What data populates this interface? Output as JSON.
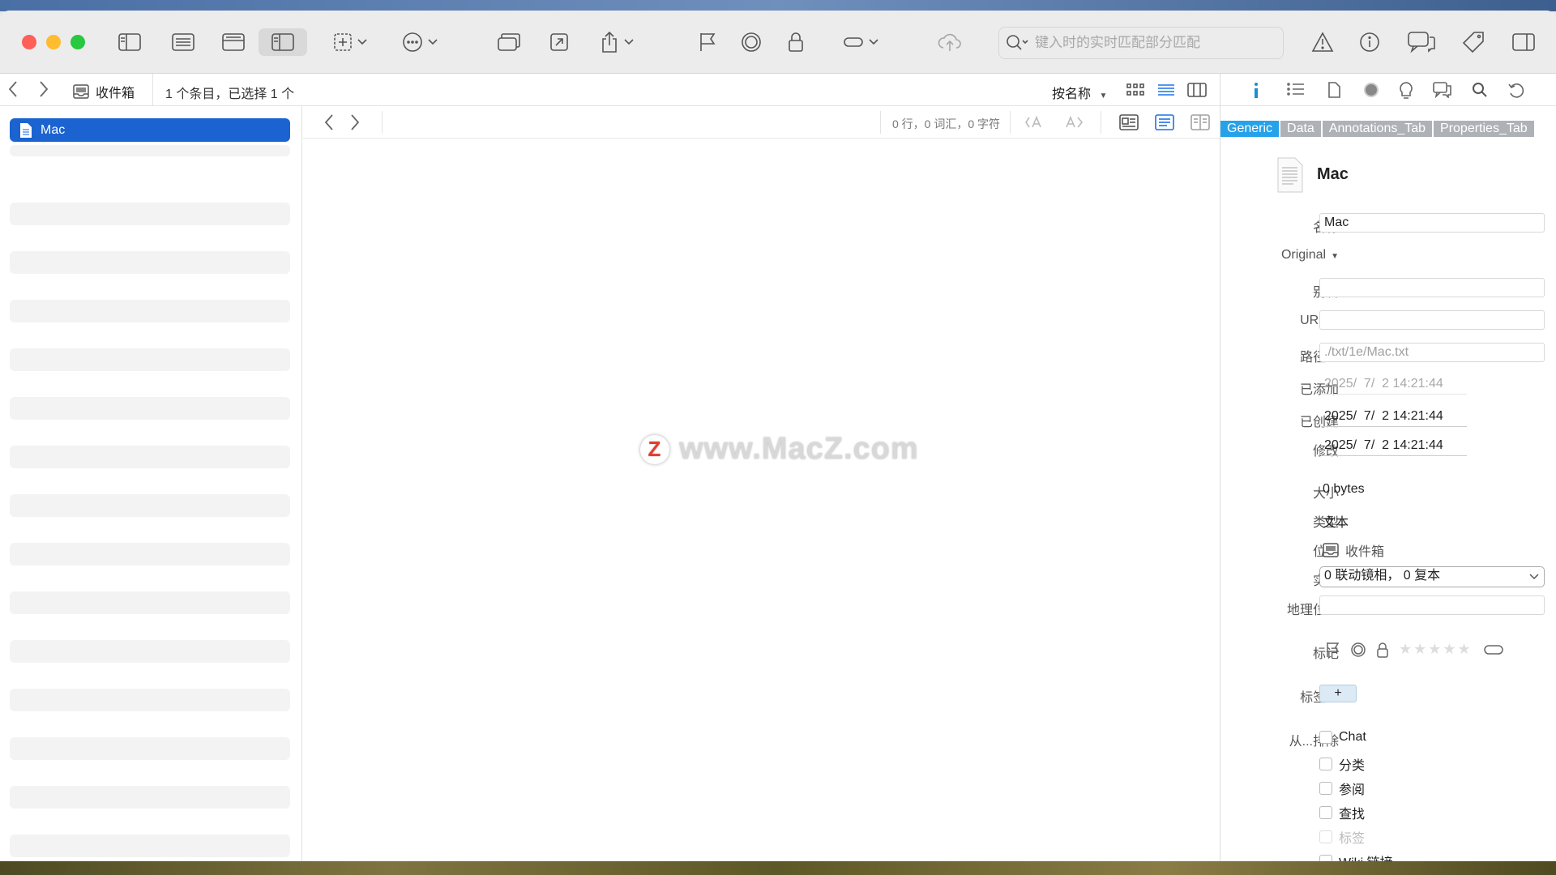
{
  "toolbar": {
    "search_placeholder": "键入时的实时匹配部分匹配"
  },
  "navbar": {
    "location": "收件箱",
    "count": "1 个条目，已选择 1 个",
    "sort_label": "按名称"
  },
  "sidebar": {
    "selected_item": "Mac"
  },
  "editor": {
    "stats": "0 行，0 词汇，0 字符",
    "watermark": "www.MacZ.com",
    "watermark_logo": "Z"
  },
  "inspector": {
    "tabs": [
      "Generic",
      "Data",
      "Annotations_Tab",
      "Properties_Tab"
    ],
    "title": "Mac",
    "labels": {
      "name": "名称",
      "original": "Original",
      "alias": "别名",
      "url": "URL",
      "path": "路径",
      "added": "已添加",
      "created": "已创建",
      "modified": "修改",
      "size": "大小",
      "kind": "类型",
      "location": "位置",
      "instances": "实例",
      "geo": "地理位置",
      "marks": "标记",
      "tags": "标签",
      "exclude": "从...排除"
    },
    "values": {
      "name": "Mac",
      "alias": "",
      "url": "",
      "path": "./txt/1e/Mac.txt",
      "added": "2025/  7/  2 14:21:44",
      "created": "2025/  7/  2 14:21:44",
      "modified": "2025/  7/  2 14:21:44",
      "size": "0 bytes",
      "kind": "文本",
      "location": "收件箱",
      "instances": "0 联动镜相，  0 复本",
      "geo": "",
      "tag_add": "+",
      "stars": "★★★★★"
    },
    "exclude_options": [
      "Chat",
      "分类",
      "参阅",
      "查找",
      "标签",
      "Wiki 链接"
    ]
  }
}
